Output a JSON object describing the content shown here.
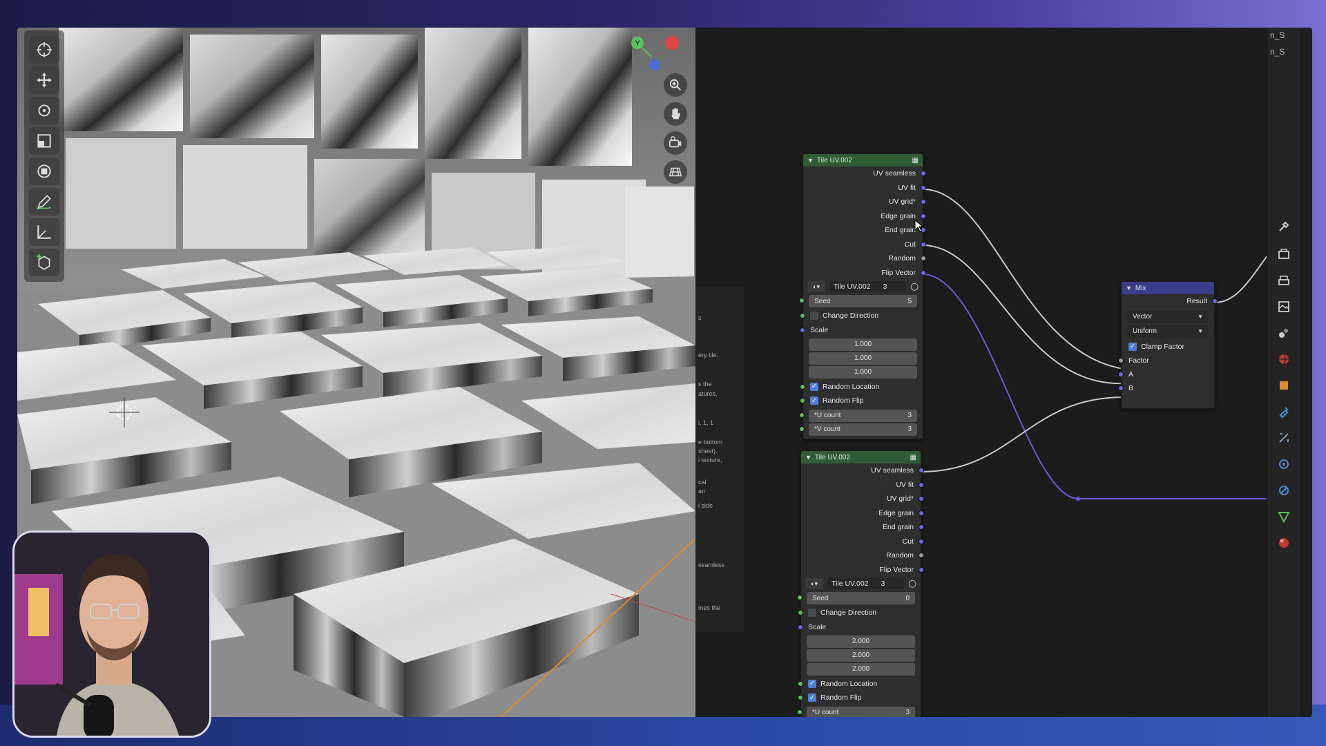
{
  "nodes": {
    "tile_top": {
      "title": "Tile UV.002",
      "outputs": [
        "UV seamless",
        "UV fit",
        "UV grid*",
        "Edge grain",
        "End grain",
        "Cut",
        "Random",
        "Flip Vector"
      ],
      "group_name": "Tile UV.002",
      "users": "3",
      "seed_label": "Seed",
      "seed_value": "5",
      "change_direction": "Change Direction",
      "scale_label": "Scale",
      "scale_values": [
        "1.000",
        "1.000",
        "1.000"
      ],
      "random_location": "Random Location",
      "random_flip": "Random Flip",
      "u_count_label": "*U count",
      "u_count_value": "3",
      "v_count_label": "*V count",
      "v_count_value": "3"
    },
    "tile_bottom": {
      "title": "Tile UV.002",
      "outputs": [
        "UV seamless",
        "UV fit",
        "UV grid*",
        "Edge grain",
        "End grain",
        "Cut",
        "Random",
        "Flip Vector"
      ],
      "group_name": "Tile UV.002",
      "users": "3",
      "seed_label": "Seed",
      "seed_value": "0",
      "change_direction": "Change Direction",
      "scale_label": "Scale",
      "scale_values": [
        "2.000",
        "2.000",
        "2.000"
      ],
      "random_location": "Random Location",
      "random_flip": "Random Flip",
      "u_count_label": "*U count",
      "u_count_value": "3"
    },
    "mix": {
      "title": "Mix",
      "result": "Result",
      "data_type": "Vector",
      "factor_mode": "Uniform",
      "clamp_factor": "Clamp Factor",
      "factor": "Factor",
      "a": "A",
      "b": "B"
    }
  },
  "side_panel_fragments": [
    "s",
    "ery tile.",
    "s the",
    "atures,",
    "i, 1, 1",
    "e bottom",
    "sheet).",
    "i texture,",
    "cal",
    "an",
    "i side",
    "seamless",
    "mes the"
  ],
  "right_sidebar_text": [
    "n_S",
    "n_S"
  ],
  "gizmo": {
    "y_label": "Y"
  },
  "colors": {
    "node_header_group": "#2f5c35",
    "node_header_mix": "#3c3d8a",
    "socket_vector": "#6b6be6",
    "wire": "#c8c8c8",
    "wire_vector": "#6a5ad6"
  }
}
